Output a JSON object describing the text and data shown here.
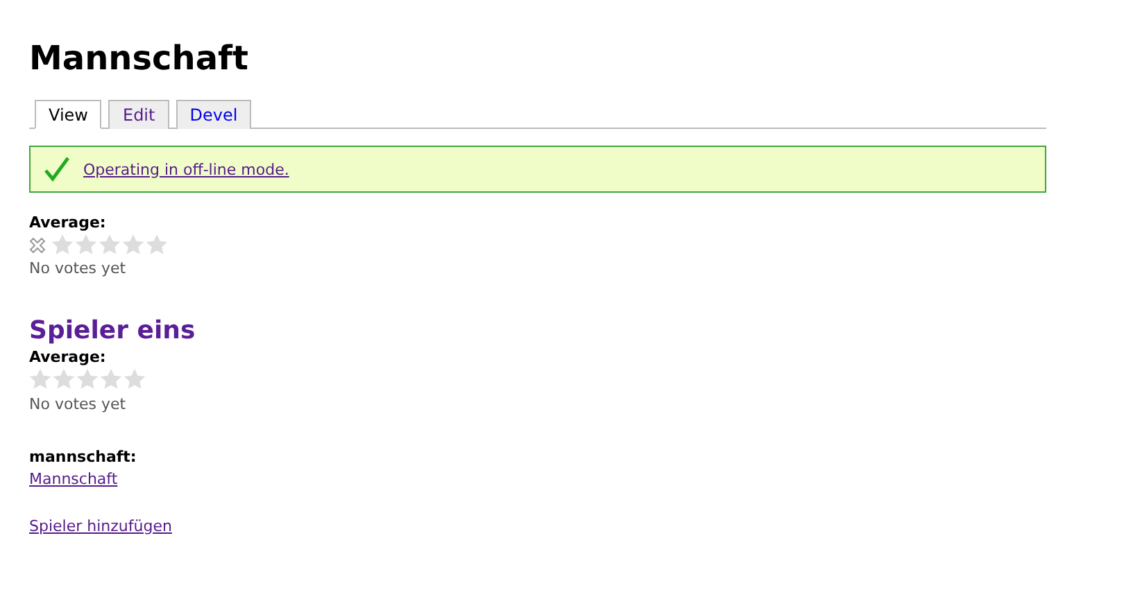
{
  "title": "Mannschaft",
  "tabs": [
    {
      "label": "View",
      "selected": true,
      "visited": false
    },
    {
      "label": "Edit",
      "selected": false,
      "visited": true
    },
    {
      "label": "Devel",
      "selected": false,
      "visited": false
    }
  ],
  "message": {
    "kind": "status",
    "text": "Operating in off-line mode."
  },
  "rating": {
    "label": "Average:",
    "cancel": true,
    "stars": 0,
    "note": "No votes yet"
  },
  "node": {
    "title": "Spieler eins",
    "rating": {
      "label": "Average:",
      "cancel": false,
      "stars": 0,
      "note": "No votes yet"
    },
    "field_label": "mannschaft:",
    "field_link": "Mannschaft"
  },
  "add_link": "Spieler hinzufügen"
}
